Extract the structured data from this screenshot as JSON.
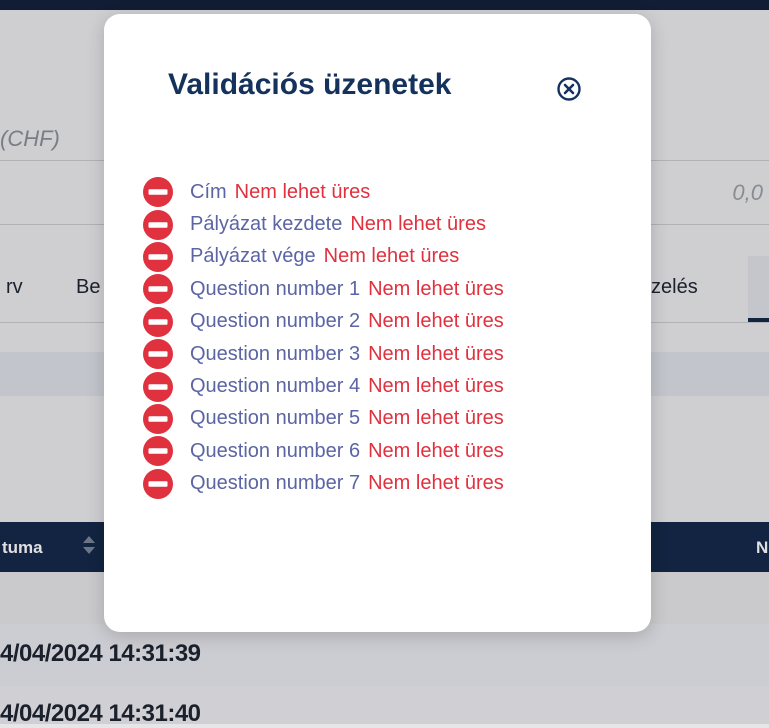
{
  "background": {
    "currency_label": "(CHF)",
    "amount_value": "0,0",
    "tabs": [
      {
        "label": "rv"
      },
      {
        "label": "Be"
      },
      {
        "label": "zelés"
      }
    ],
    "table_header": {
      "col_date": "tuma",
      "col_next": "N"
    },
    "rows": [
      {
        "date": "4/04/2024 14:31:39"
      },
      {
        "date": "4/04/2024 14:31:40"
      }
    ]
  },
  "modal": {
    "title": "Validációs üzenetek",
    "close_icon": "circled-x-icon",
    "messages": [
      {
        "field": "Cím",
        "error": "Nem lehet üres"
      },
      {
        "field": "Pályázat kezdete",
        "error": "Nem lehet üres"
      },
      {
        "field": "Pályázat vége",
        "error": "Nem lehet üres"
      },
      {
        "field": "Question number 1",
        "error": "Nem lehet üres"
      },
      {
        "field": "Question number 2",
        "error": "Nem lehet üres"
      },
      {
        "field": "Question number 3",
        "error": "Nem lehet üres"
      },
      {
        "field": "Question number 4",
        "error": "Nem lehet üres"
      },
      {
        "field": "Question number 5",
        "error": "Nem lehet üres"
      },
      {
        "field": "Question number 6",
        "error": "Nem lehet üres"
      },
      {
        "field": "Question number 7",
        "error": "Nem lehet üres"
      }
    ]
  },
  "colors": {
    "title": "#15325c",
    "field": "#5b64a5",
    "error": "#e0313f",
    "header_bg": "#15294b"
  }
}
